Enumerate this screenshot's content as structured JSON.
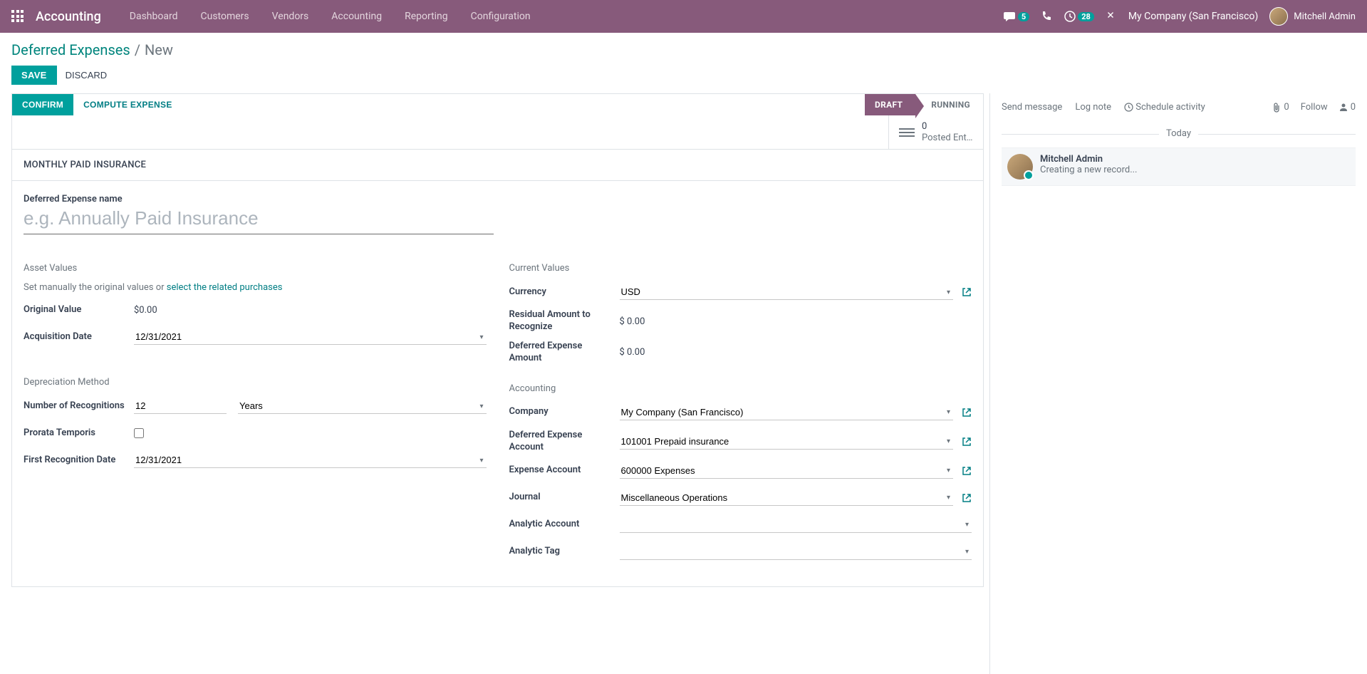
{
  "topbar": {
    "app_title": "Accounting",
    "nav": [
      "Dashboard",
      "Customers",
      "Vendors",
      "Accounting",
      "Reporting",
      "Configuration"
    ],
    "msg_count": "5",
    "act_count": "28",
    "company": "My Company (San Francisco)",
    "user": "Mitchell Admin"
  },
  "breadcrumbs": {
    "parent": "Deferred Expenses",
    "current": "New"
  },
  "actions": {
    "save": "SAVE",
    "discard": "DISCARD"
  },
  "statusbar": {
    "confirm": "CONFIRM",
    "compute": "COMPUTE EXPENSE",
    "draft": "DRAFT",
    "running": "RUNNING"
  },
  "smart": {
    "posted_count": "0",
    "posted_label": "Posted Ent..."
  },
  "ribbon": "MONTHLY PAID INSURANCE",
  "name": {
    "label": "Deferred Expense name",
    "placeholder": "e.g. Annually Paid Insurance",
    "value": ""
  },
  "sections": {
    "asset_values": "Asset Values",
    "current_values": "Current Values",
    "depreciation": "Depreciation Method",
    "accounting": "Accounting"
  },
  "asset": {
    "helper_prefix": "Set manually the original values or ",
    "helper_link": "select the related purchases",
    "original_value_label": "Original Value",
    "original_value": "$0.00",
    "acq_date_label": "Acquisition Date",
    "acq_date": "12/31/2021"
  },
  "current": {
    "currency_label": "Currency",
    "currency": "USD",
    "residual_label": "Residual Amount to Recognize",
    "residual": "$ 0.00",
    "deferred_label": "Deferred Expense Amount",
    "deferred": "$ 0.00"
  },
  "depr": {
    "num_label": "Number of Recognitions",
    "num": "12",
    "period": "Years",
    "prorata_label": "Prorata Temporis",
    "first_date_label": "First Recognition Date",
    "first_date": "12/31/2021"
  },
  "acct": {
    "company_label": "Company",
    "company": "My Company (San Francisco)",
    "def_acct_label": "Deferred Expense Account",
    "def_acct": "101001 Prepaid insurance",
    "exp_acct_label": "Expense Account",
    "exp_acct": "600000 Expenses",
    "journal_label": "Journal",
    "journal": "Miscellaneous Operations",
    "ana_acct_label": "Analytic Account",
    "ana_acct": "",
    "ana_tag_label": "Analytic Tag",
    "ana_tag": ""
  },
  "chat": {
    "send": "Send message",
    "log": "Log note",
    "schedule": "Schedule activity",
    "attach_count": "0",
    "follow": "Follow",
    "follower_count": "0",
    "today": "Today",
    "msg_author": "Mitchell Admin",
    "msg_text": "Creating a new record..."
  }
}
